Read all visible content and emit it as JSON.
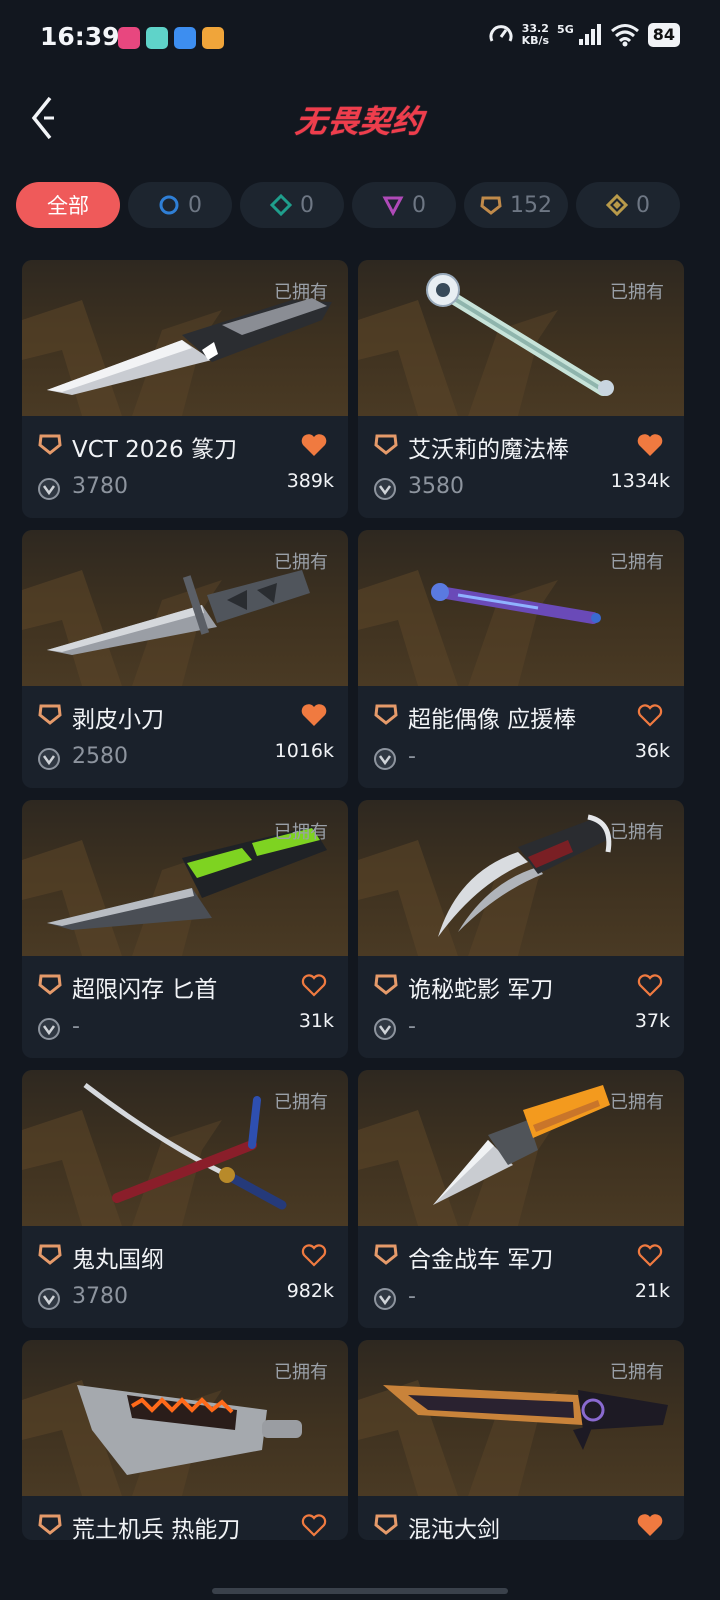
{
  "status_bar": {
    "time": "16:39",
    "net_speed_value": "33.2",
    "net_speed_unit": "KB/s",
    "network": "5G",
    "battery": "84",
    "app_icon_colors": [
      "#e8477f",
      "#5fd3c9",
      "#3d8ef0",
      "#f0a53a"
    ]
  },
  "header": {
    "back_icon": "chevron-left-icon",
    "title": "无畏契约"
  },
  "filters": [
    {
      "label": "全部",
      "icon": "",
      "active": true
    },
    {
      "label": "0",
      "icon": "tier-select-icon",
      "color": "#2f7fd6",
      "active": false
    },
    {
      "label": "0",
      "icon": "tier-deluxe-icon",
      "color": "#1f9e8c",
      "active": false
    },
    {
      "label": "0",
      "icon": "tier-premium-icon",
      "color": "#b04ab9",
      "active": false
    },
    {
      "label": "152",
      "icon": "tier-exclusive-icon",
      "color": "#c08a4a",
      "active": false
    },
    {
      "label": "0",
      "icon": "tier-ultra-icon",
      "color": "#b89a4a",
      "active": false
    }
  ],
  "colors": {
    "accent": "#ef5a5a",
    "heart": "#f07a40",
    "tier_exclusive": "#e59a6a"
  },
  "cards": [
    {
      "name": "VCT 2026 篆刀",
      "price": "3780",
      "likes": "389k",
      "owned": "已拥有",
      "liked": true,
      "weapon": "knife-silver"
    },
    {
      "name": "艾沃莉的魔法棒",
      "price": "3580",
      "likes": "1334k",
      "owned": "已拥有",
      "liked": true,
      "weapon": "wand"
    },
    {
      "name": "剥皮小刀",
      "price": "2580",
      "likes": "1016k",
      "owned": "已拥有",
      "liked": true,
      "weapon": "knife-serrated"
    },
    {
      "name": "超能偶像 应援棒",
      "price": "-",
      "likes": "36k",
      "owned": "已拥有",
      "liked": false,
      "weapon": "lightstick"
    },
    {
      "name": "超限闪存 匕首",
      "price": "-",
      "likes": "31k",
      "owned": "已拥有",
      "liked": false,
      "weapon": "knife-green"
    },
    {
      "name": "诡秘蛇影 军刀",
      "price": "-",
      "likes": "37k",
      "owned": "已拥有",
      "liked": false,
      "weapon": "claws"
    },
    {
      "name": "鬼丸国纲",
      "price": "3780",
      "likes": "982k",
      "owned": "已拥有",
      "liked": false,
      "weapon": "katana"
    },
    {
      "name": "合金战车 军刀",
      "price": "-",
      "likes": "21k",
      "owned": "已拥有",
      "liked": false,
      "weapon": "knife-orange"
    },
    {
      "name": "荒土机兵 热能刀",
      "price": "",
      "likes": "",
      "owned": "已拥有",
      "liked": false,
      "weapon": "cleaver"
    },
    {
      "name": "混沌大剑",
      "price": "",
      "likes": "",
      "owned": "已拥有",
      "liked": true,
      "weapon": "greatsword"
    }
  ]
}
